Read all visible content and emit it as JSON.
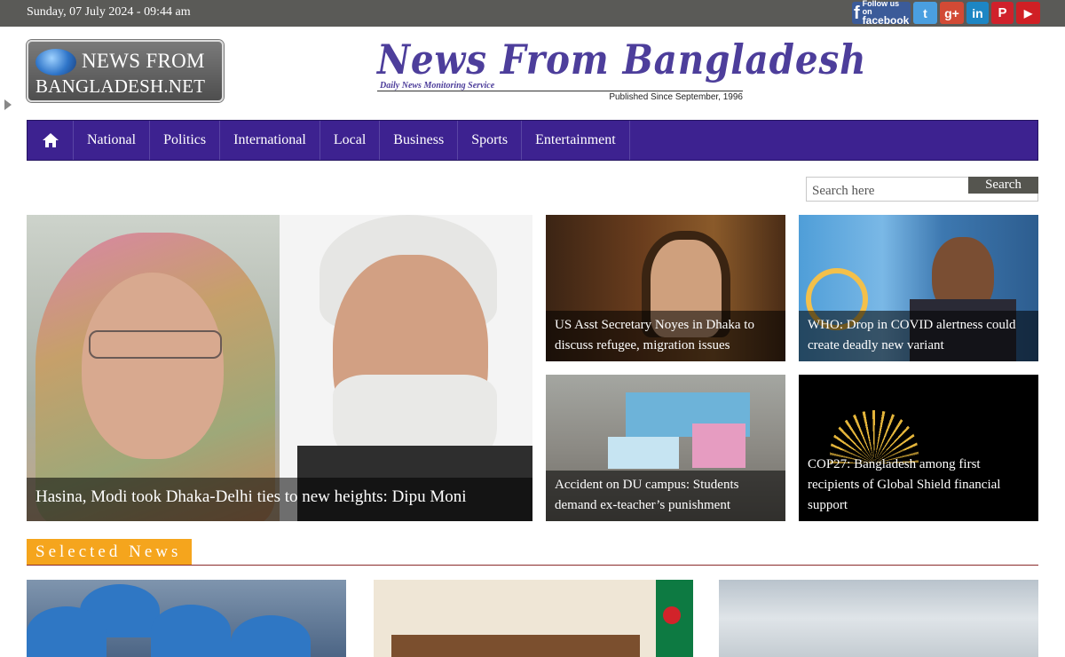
{
  "topbar": {
    "date": "Sunday, 07 July 2024 - 09:44 am",
    "social": [
      {
        "name": "facebook",
        "line1": "Follow us on",
        "line2": "facebook"
      },
      {
        "name": "twitter",
        "glyph": "t"
      },
      {
        "name": "google-plus",
        "glyph": "g+"
      },
      {
        "name": "linkedin",
        "glyph": "in"
      },
      {
        "name": "pinterest",
        "glyph": "P"
      },
      {
        "name": "youtube",
        "glyph": "▶"
      }
    ],
    "colors": {
      "bar": "#5a5a57"
    }
  },
  "header": {
    "logo_line1": "NEWS FROM",
    "logo_line2": "BANGLADESH.NET",
    "masthead_title": "News From Bangladesh",
    "masthead_tagline": "Daily News Monitoring Service",
    "masthead_published": "Published Since September, 1996"
  },
  "nav": {
    "home_icon": "home-icon",
    "items": [
      "National",
      "Politics",
      "International",
      "Local",
      "Business",
      "Sports",
      "Entertainment"
    ],
    "color": "#3d2290"
  },
  "search": {
    "placeholder": "Search here",
    "button": "Search"
  },
  "featured": {
    "main": {
      "caption": "Hasina, Modi took Dhaka-Delhi ties to new heights: Dipu Moni"
    },
    "cards": [
      {
        "caption": "US Asst Secretary Noyes in Dhaka to discuss refugee, migration issues"
      },
      {
        "caption": "WHO: Drop in COVID alertness could create deadly new variant"
      },
      {
        "caption": "Accident on DU campus: Students demand ex-teacher’s punishment"
      },
      {
        "caption": "COP27: Bangladesh among first recipients of Global Shield financial support"
      }
    ]
  },
  "selected": {
    "heading": "Selected News",
    "accent": "#f5a51d"
  }
}
